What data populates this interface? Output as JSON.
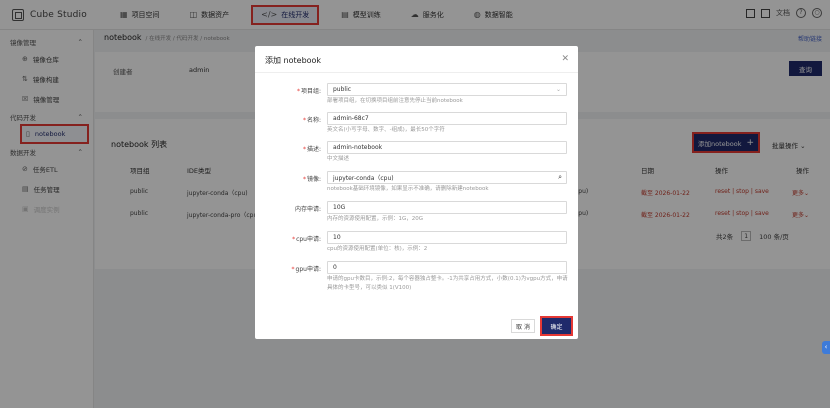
{
  "app": {
    "name": "Cube Studio"
  },
  "nav": [
    {
      "icon": "▦",
      "label": "项目空间"
    },
    {
      "icon": "◫",
      "label": "数据资产"
    },
    {
      "icon": "</>",
      "label": "在线开发"
    },
    {
      "icon": "▤",
      "label": "模型训练"
    },
    {
      "icon": "☁",
      "label": "服务化"
    },
    {
      "icon": "◍",
      "label": "数据智能"
    }
  ],
  "topright": {
    "doc_label": "文档"
  },
  "sidebar": {
    "groups": [
      {
        "label": "镜像管理",
        "chev": "⌃",
        "items": [
          {
            "icon": "⊕",
            "label": "镜像仓库"
          },
          {
            "icon": "⇅",
            "label": "镜像构建"
          },
          {
            "icon": "☒",
            "label": "镜像管理"
          }
        ]
      },
      {
        "label": "代码开发",
        "chev": "⌃",
        "items": [
          {
            "icon": "▯",
            "label": "notebook"
          }
        ]
      },
      {
        "label": "数据开发",
        "chev": "⌃",
        "items": [
          {
            "icon": "⊘",
            "label": "任务ETL"
          },
          {
            "icon": "▤",
            "label": "任务管理"
          },
          {
            "icon": "▣",
            "label": "调度实例"
          }
        ]
      }
    ]
  },
  "page": {
    "title": "notebook",
    "breadcrumb": "/ 在线开发 / 代码开发 / notebook",
    "help": "帮助链接",
    "filter_label": "创建者",
    "filter_value": "admin",
    "query": "查询"
  },
  "table": {
    "title": "notebook 列表",
    "add_label": "添加notebook",
    "batch_label": "批量操作",
    "headers": [
      "项目组",
      "IDE类型",
      "日期",
      "操作",
      "操作"
    ],
    "rows": [
      {
        "project": "public",
        "ide": "jupyter-conda（cpu)",
        "cpu": "cpu)",
        "date": "截至 2026-01-22",
        "ops": "reset | stop | save",
        "more": "更多"
      },
      {
        "project": "public",
        "ide": "jupyter-conda-pro（cpu)",
        "cpu": "cpu)",
        "date": "截至 2026-01-22",
        "ops": "reset | stop | save",
        "more": "更多"
      }
    ],
    "pager": {
      "total": "共2条",
      "page": "1",
      "size": "100 条/页"
    }
  },
  "modal": {
    "title": "添加 notebook",
    "fields": [
      {
        "label": "项目组:",
        "required": true,
        "value": "public",
        "help": "部署项目组，在切换项目组前注意先停止当前notebook",
        "kind": "select"
      },
      {
        "label": "名称:",
        "required": true,
        "value": "admin-68c7",
        "help": "英文名(小写字母、数字、-组成)，最长50个字符",
        "kind": "text"
      },
      {
        "label": "描述:",
        "required": true,
        "value": "admin-notebook",
        "help": "中文描述",
        "kind": "text"
      },
      {
        "label": "镜像:",
        "required": true,
        "value": "jupyter-conda（cpu)",
        "help": "notebook基础环境镜像，如果显示不准确，请删除新建notebook",
        "kind": "search"
      },
      {
        "label": "内存申请:",
        "required": false,
        "value": "10G",
        "help": "内存的资源使用配置，示例：1G，20G",
        "kind": "text"
      },
      {
        "label": "cpu申请:",
        "required": true,
        "value": "10",
        "help": "cpu的资源使用配置(单位：核)，示例：2",
        "kind": "text"
      },
      {
        "label": "gpu申请:",
        "required": true,
        "value": "0",
        "help": "申请的gpu卡数目，示例:2，每个容器独占整卡。-1为共享占用方式，小数(0.1)为vgpu方式，申请具体的卡型号，可以类似 1(V100)",
        "kind": "text"
      }
    ],
    "cancel": "取 消",
    "ok": "确定"
  }
}
